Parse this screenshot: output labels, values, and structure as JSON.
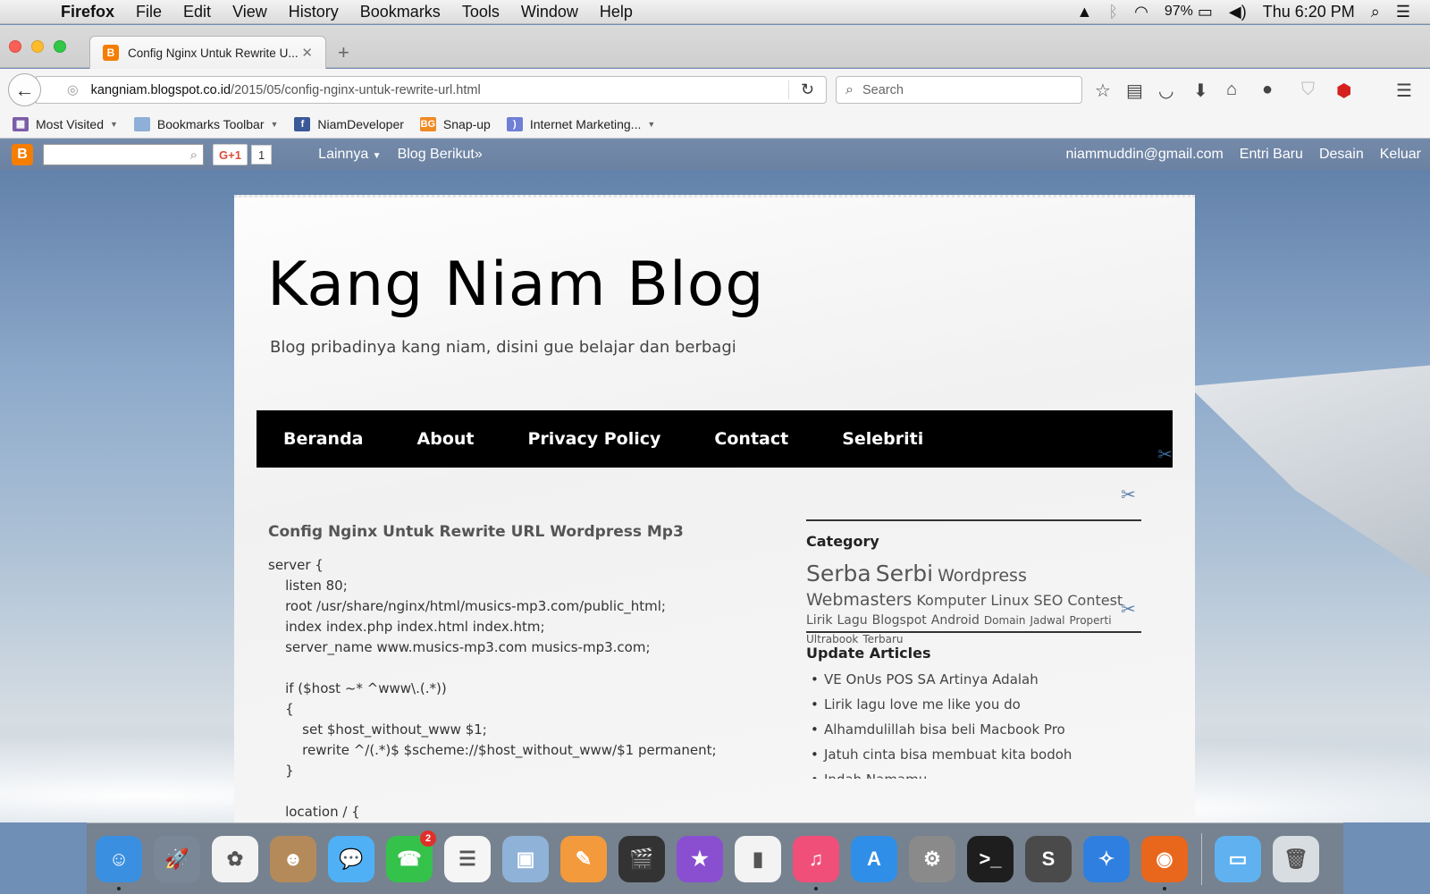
{
  "menubar": {
    "app_name": "Firefox",
    "items": [
      "File",
      "Edit",
      "View",
      "History",
      "Bookmarks",
      "Tools",
      "Window",
      "Help"
    ],
    "battery": "97%",
    "clock": "Thu 6:20 PM"
  },
  "tab": {
    "title": "Config Nginx Untuk Rewrite U...",
    "close": "✕",
    "new_tab": "+"
  },
  "urlbar": {
    "domain": "kangniam.blogspot.co.id",
    "path": "/2015/05/config-nginx-untuk-rewrite-url.html"
  },
  "searchbar": {
    "placeholder": "Search"
  },
  "bookmarks": [
    {
      "label": "Most Visited",
      "icon": "most-visited-icon",
      "color": "#7b5ea7"
    },
    {
      "label": "Bookmarks Toolbar",
      "icon": "folder-icon",
      "color": "#8fb0d6"
    },
    {
      "label": "NiamDeveloper",
      "icon": "facebook-icon",
      "color": "#3b5998"
    },
    {
      "label": "Snap-up",
      "icon": "bg-icon",
      "color": "#f08a24"
    },
    {
      "label": "Internet Marketing...",
      "icon": "rss-icon",
      "color": "#6f7fd6"
    }
  ],
  "bloggerbar": {
    "gplus_label": "G+1",
    "gplus_count": "1",
    "more": "Lainnya",
    "next_blog": "Blog Berikut»",
    "email": "niammuddin@gmail.com",
    "new_post": "Entri Baru",
    "design": "Desain",
    "logout": "Keluar"
  },
  "blog": {
    "title": "Kang Niam Blog",
    "description": "Blog pribadinya kang niam, disini gue belajar dan berbagi",
    "nav": [
      "Beranda",
      "About",
      "Privacy Policy",
      "Contact",
      "Selebriti"
    ]
  },
  "post": {
    "title": "Config Nginx Untuk Rewrite URL Wordpress Mp3",
    "lines": [
      "server {",
      "    listen 80;",
      "    root /usr/share/nginx/html/musics-mp3.com/public_html;",
      "    index index.php index.html index.htm;",
      "    server_name www.musics-mp3.com musics-mp3.com;",
      " ",
      "    if ($host ~* ^www\\.(.*))",
      "    {",
      "        set $host_without_www $1;",
      "        rewrite ^/(.*)$ $scheme://$host_without_www/$1 permanent;",
      "    }",
      " ",
      "    location / {"
    ]
  },
  "sidebar": {
    "category_title": "Category",
    "labels": [
      {
        "text": "Serba",
        "size": 25
      },
      {
        "text": "Serbi",
        "size": 25
      },
      {
        "text": "Wordpress",
        "size": 19
      },
      {
        "text": "Webmasters",
        "size": 19
      },
      {
        "text": "Komputer",
        "size": 16
      },
      {
        "text": "Linux",
        "size": 16
      },
      {
        "text": "SEO",
        "size": 16
      },
      {
        "text": "Contest",
        "size": 16
      },
      {
        "text": "Lirik",
        "size": 14
      },
      {
        "text": "Lagu",
        "size": 14
      },
      {
        "text": "Blogspot",
        "size": 14
      },
      {
        "text": "Android",
        "size": 14
      },
      {
        "text": "Domain",
        "size": 12
      },
      {
        "text": "Jadwal",
        "size": 12
      },
      {
        "text": "Properti",
        "size": 12
      },
      {
        "text": "Ultrabook",
        "size": 12
      },
      {
        "text": "Terbaru",
        "size": 12
      }
    ],
    "updates_title": "Update Articles",
    "updates": [
      "VE OnUs POS SA Artinya Adalah",
      "Lirik lagu love me like you do",
      "Alhamdulillah bisa beli Macbook Pro",
      "Jatuh cinta bisa membuat kita bodoh",
      "Indah Namamu"
    ]
  },
  "dock": [
    {
      "name": "finder-icon",
      "glyph": "☺",
      "color": "#3b8fe0",
      "running": true
    },
    {
      "name": "launchpad-icon",
      "glyph": "🚀",
      "color": "#7a8796"
    },
    {
      "name": "photos-icon",
      "glyph": "✿",
      "color": "#f2f2f2"
    },
    {
      "name": "contacts-icon",
      "glyph": "☻",
      "color": "#b58a5a"
    },
    {
      "name": "messages-icon",
      "glyph": "💬",
      "color": "#4fb0f5"
    },
    {
      "name": "facetime-icon",
      "glyph": "☎",
      "color": "#35c24b",
      "badge": "2"
    },
    {
      "name": "reminders-icon",
      "glyph": "☰",
      "color": "#f5f5f5"
    },
    {
      "name": "preview-icon",
      "glyph": "▣",
      "color": "#8fb2d8"
    },
    {
      "name": "pages-icon",
      "glyph": "✎",
      "color": "#f39a3d"
    },
    {
      "name": "final-cut-icon",
      "glyph": "🎬",
      "color": "#333333"
    },
    {
      "name": "imovie-icon",
      "glyph": "★",
      "color": "#8a4fd1"
    },
    {
      "name": "numbers-icon",
      "glyph": "▮",
      "color": "#f3f3f3"
    },
    {
      "name": "itunes-icon",
      "glyph": "♫",
      "color": "#f04f7a",
      "running": true
    },
    {
      "name": "app-store-icon",
      "glyph": "A",
      "color": "#2f8fe8"
    },
    {
      "name": "system-preferences-icon",
      "glyph": "⚙",
      "color": "#8a8a8a"
    },
    {
      "name": "terminal-icon",
      "glyph": ">_",
      "color": "#1e1e1e"
    },
    {
      "name": "sublime-text-icon",
      "glyph": "S",
      "color": "#4a4a4a"
    },
    {
      "name": "safari-icon",
      "glyph": "✧",
      "color": "#2f7fe0"
    },
    {
      "name": "firefox-icon",
      "glyph": "◉",
      "color": "#e8671c",
      "running": true
    },
    {
      "name": "folder-icon",
      "glyph": "▭",
      "color": "#5fb2ef"
    },
    {
      "name": "trash-icon",
      "glyph": "🗑",
      "color": "#d8dde2"
    }
  ]
}
